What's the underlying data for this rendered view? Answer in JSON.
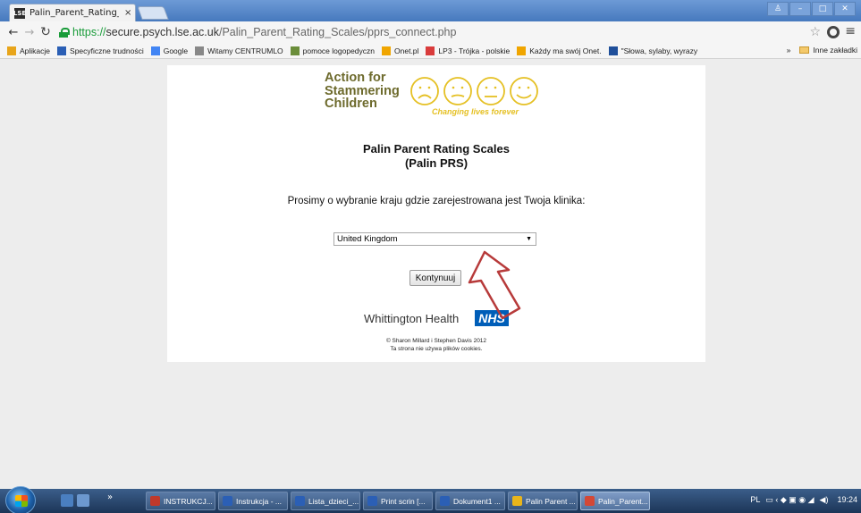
{
  "browser": {
    "tab_title": "Palin_Parent_Rating_Scale",
    "tab_favicon": "LSE",
    "tab_close": "×",
    "url_proto": "https://",
    "url_host": "secure.psych.lse.ac.uk",
    "url_path": "/Palin_Parent_Rating_Scales/pprs_connect.php",
    "bookmarks": [
      {
        "label": "Aplikacje",
        "icon": "apps-icon",
        "color": "#e8a51b"
      },
      {
        "label": "Specyficzne trudności",
        "icon": "bookmark-icon",
        "color": "#2b5fb5"
      },
      {
        "label": "Google",
        "icon": "google-icon",
        "color": "#4285f4"
      },
      {
        "label": "Witamy CENTRUMLO",
        "icon": "page-icon",
        "color": "#888888"
      },
      {
        "label": "pomoce logopedyczn",
        "icon": "image-icon",
        "color": "#6a8d3a"
      },
      {
        "label": "Onet.pl",
        "icon": "onet-icon",
        "color": "#f0a500"
      },
      {
        "label": "LP3 - Trójka - polskie",
        "icon": "lp3-icon",
        "color": "#d93b3b"
      },
      {
        "label": "Każdy ma swój Onet.",
        "icon": "onet-icon",
        "color": "#f0a500"
      },
      {
        "label": "\"Słowa, sylaby, wyrazy",
        "icon": "wp-icon",
        "color": "#1f4f9a"
      }
    ],
    "bookmarks_more": "»",
    "other_bookmarks": "Inne zakładki"
  },
  "page": {
    "logo_line1": "Action for",
    "logo_line2": "Stammering",
    "logo_line3": "Children",
    "logo_tagline": "Changing lives forever",
    "title_line1": "Palin Parent Rating Scales",
    "title_line2": "(Palin PRS)",
    "prompt": "Prosimy o wybranie kraju gdzie zarejestrowana jest Twoja klinika:",
    "country_selected": "United Kingdom",
    "continue_button": "Kontynuuj",
    "nhs_text": "Whittington Health",
    "nhs_badge": "NHS",
    "credit_line1": "© Sharon Millard i Stephen Davis 2012",
    "credit_line2": "Ta strona nie używa plików cookies."
  },
  "taskbar": {
    "items": [
      {
        "label": "INSTRUKCJ...",
        "color": "#c0392b"
      },
      {
        "label": "Instrukcja - ...",
        "color": "#2b5fb5"
      },
      {
        "label": "Lista_dzieci_...",
        "color": "#2b5fb5"
      },
      {
        "label": "Print scrin [...",
        "color": "#2b5fb5"
      },
      {
        "label": "Dokument1 ...",
        "color": "#2b5fb5"
      },
      {
        "label": "Palin Parent ...",
        "color": "#e8b51b"
      },
      {
        "label": "Palin_Parent...",
        "color": "#d34836"
      }
    ],
    "language": "PL",
    "clock": "19:24"
  }
}
